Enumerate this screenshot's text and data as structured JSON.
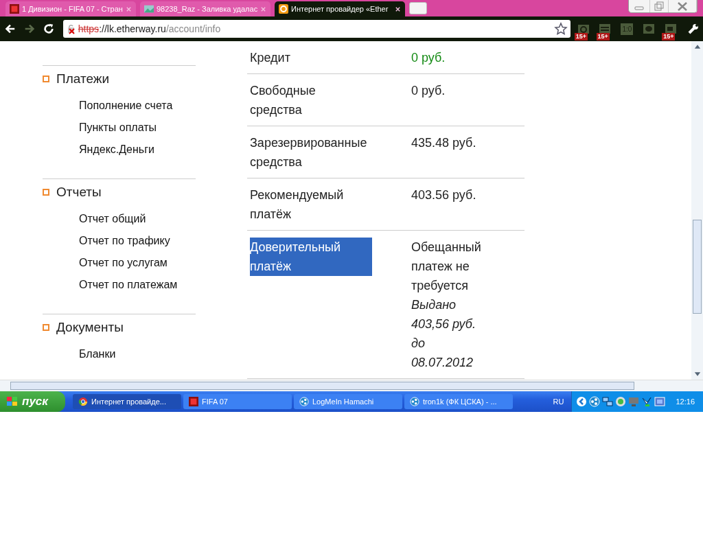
{
  "browser": {
    "tabs": [
      {
        "title": "1 Дивизион - FIFA 07 - Стран",
        "kind": "game",
        "selected": false
      },
      {
        "title": "98238_Raz - Заливка удалас",
        "kind": "image",
        "selected": false
      },
      {
        "title": "Интернет провайдер «Ether",
        "kind": "site",
        "selected": true
      }
    ],
    "address": {
      "scheme": "https",
      "rest": "://lk.etherway.ru",
      "path": "/account/info"
    },
    "extensions": [
      {
        "kind": "camera",
        "badge": "15+"
      },
      {
        "kind": "list",
        "badge": "15+"
      },
      {
        "kind": "score",
        "label": "1:0"
      },
      {
        "kind": "chat"
      },
      {
        "kind": "video",
        "badge": "15+"
      }
    ]
  },
  "sidebar": [
    {
      "title": "Платежи",
      "items": [
        "Пополнение счета",
        "Пункты оплаты",
        "Яндекс.Деньги"
      ]
    },
    {
      "title": "Отчеты",
      "items": [
        "Отчет общий",
        "Отчет по трафику",
        "Отчет по услугам",
        "Отчет по платежам"
      ]
    },
    {
      "title": "Документы",
      "items": [
        "Бланки"
      ]
    }
  ],
  "table": [
    {
      "label": "Кредит",
      "value": "0 руб.",
      "positive": true,
      "highlighted": false
    },
    {
      "label": "Свободные средства",
      "value": "0 руб.",
      "positive": false,
      "highlighted": false
    },
    {
      "label": "Зарезервированные средства",
      "value": "435.48 руб.",
      "positive": false,
      "highlighted": false
    },
    {
      "label": "Рекомендуемый платёж",
      "value": "403.56 руб.",
      "positive": false,
      "highlighted": false
    },
    {
      "label": "Доверительный платёж",
      "value": "Обещанный платеж не требуется",
      "note": "Выдано 403,56 руб. до 08.07.2012",
      "positive": false,
      "highlighted": true
    }
  ],
  "taskbar": {
    "start": "пуск",
    "tasks": [
      {
        "title": "Интернет провайде...",
        "kind": "browser",
        "selected": true
      },
      {
        "title": "FIFA 07",
        "kind": "game",
        "selected": false
      },
      {
        "title": "LogMeIn Hamachi",
        "kind": "network",
        "selected": false
      },
      {
        "title": "tron1k (ФК ЦСКА) - ...",
        "kind": "network",
        "selected": false
      }
    ],
    "language": "RU",
    "time": "12:16"
  }
}
